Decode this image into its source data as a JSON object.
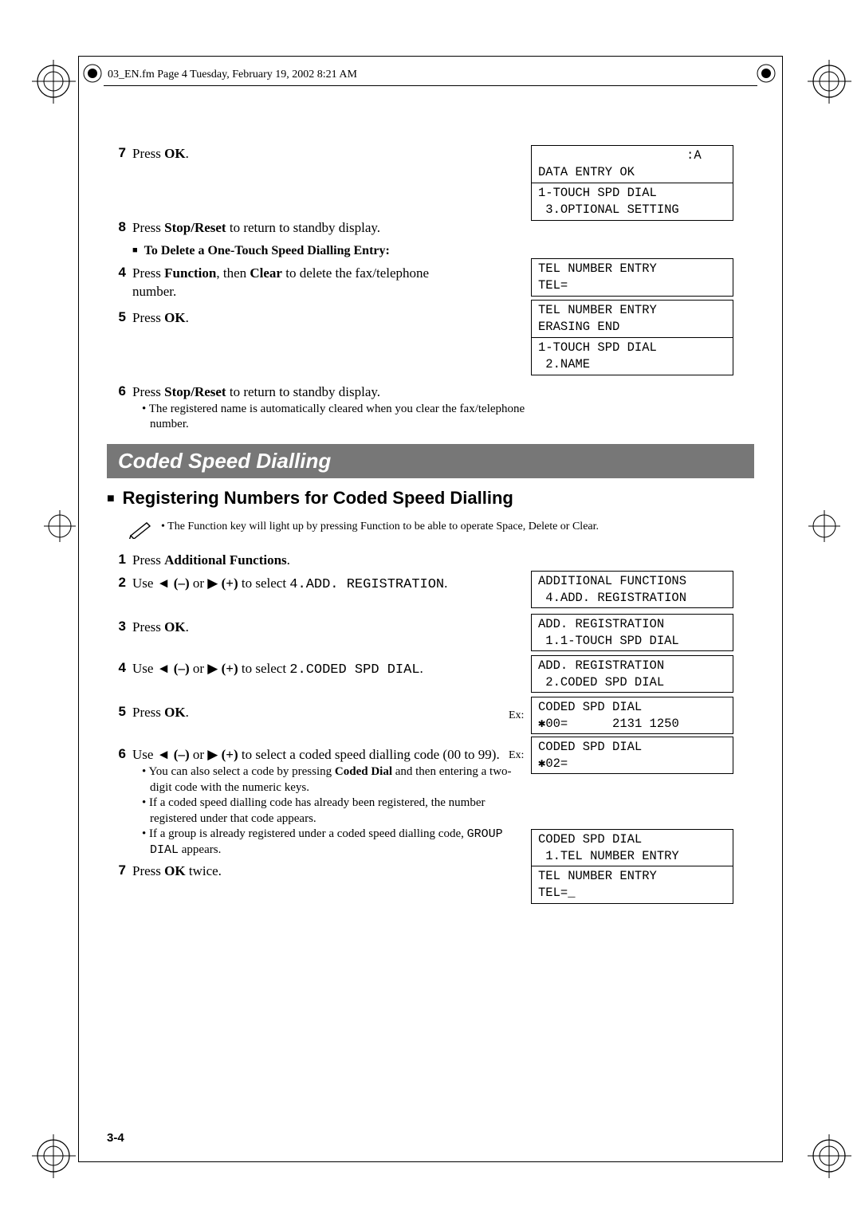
{
  "header": "03_EN.fm  Page 4  Tuesday, February 19, 2002  8:21 AM",
  "stepsA": {
    "s7": {
      "num": "7",
      "text_a": "Press ",
      "bold": "OK",
      "text_b": "."
    },
    "s8": {
      "num": "8",
      "text_a": "Press ",
      "bold": "Stop/Reset",
      "text_b": " to return to standby display."
    },
    "sub": "To Delete a One-Touch Speed Dialling Entry:",
    "s4": {
      "num": "4",
      "text_a": "Press ",
      "bold1": "Function",
      "mid": ", then ",
      "bold2": "Clear",
      "text_b": " to delete the fax/telephone number."
    },
    "s5": {
      "num": "5",
      "text_a": "Press ",
      "bold": "OK",
      "text_b": "."
    },
    "s6": {
      "num": "6",
      "text_a": "Press ",
      "bold": "Stop/Reset",
      "text_b": " to return to standby display.",
      "note": "The registered name is automatically cleared when you clear the fax/telephone number."
    }
  },
  "lcdA": {
    "box1a": "                    :A\nDATA ENTRY OK",
    "box1b": "1-TOUCH SPD DIAL\n 3.OPTIONAL SETTING",
    "box2": "TEL NUMBER ENTRY\nTEL=",
    "box3a": "TEL NUMBER ENTRY\nERASING END",
    "box3b": "1-TOUCH SPD DIAL\n 2.NAME"
  },
  "section": "Coded Speed Dialling",
  "subsection": "Registering Numbers for Coded Speed Dialling",
  "tip": {
    "a": "The ",
    "b1": "Function",
    "c": " key will light up by pressing ",
    "b2": "Function",
    "d": " to be able to operate ",
    "b3": "Space",
    "e": ", ",
    "b4": "Delete",
    "f": " or ",
    "b5": "Clear",
    "g": "."
  },
  "stepsB": {
    "s1": {
      "num": "1",
      "text_a": "Press ",
      "bold": "Additional Functions",
      "text_b": "."
    },
    "s2": {
      "num": "2",
      "text_a": "Use ",
      "l1": "◄",
      "b1": " (–)",
      "or": " or ",
      "r1": "▶",
      "b2": " (+)",
      "tail": " to select ",
      "mono": "4.ADD. REGISTRATION",
      "text_b": "."
    },
    "s3": {
      "num": "3",
      "text_a": "Press ",
      "bold": "OK",
      "text_b": "."
    },
    "s4": {
      "num": "4",
      "text_a": "Use ",
      "l1": "◄",
      "b1": " (–)",
      "or": " or ",
      "r1": "▶",
      "b2": " (+)",
      "tail": " to select ",
      "mono": "2.CODED SPD DIAL",
      "text_b": "."
    },
    "s5": {
      "num": "5",
      "text_a": "Press ",
      "bold": "OK",
      "text_b": "."
    },
    "s6": {
      "num": "6",
      "text_a": "Use ",
      "l1": "◄",
      "b1": " (–)",
      "or": " or ",
      "r1": "▶",
      "b2": " (+)",
      "tail": " to select a coded speed dialling code (00 to 99).",
      "note1a": "You can also select a code by pressing ",
      "note1b": "Coded Dial",
      "note1c": " and then entering a two-digit code with the numeric keys.",
      "note2": "If a coded speed dialling code has already been registered, the number registered under that code appears.",
      "note3a": "If a group is already registered under a coded speed dialling code, ",
      "note3m": "GROUP DIAL",
      "note3b": " appears."
    },
    "s7": {
      "num": "7",
      "text_a": "Press ",
      "bold": "OK",
      "text_b": " twice."
    }
  },
  "lcdB": {
    "b1": "ADDITIONAL FUNCTIONS\n 4.ADD. REGISTRATION",
    "b2": "ADD. REGISTRATION\n 1.1-TOUCH SPD DIAL",
    "b3": "ADD. REGISTRATION\n 2.CODED SPD DIAL",
    "b4": "CODED SPD DIAL\n✱00=      2131 1250",
    "ex1": "Ex:",
    "b5": "CODED SPD DIAL\n✱02=",
    "ex2": "Ex:",
    "b6": "CODED SPD DIAL\n 1.TEL NUMBER ENTRY",
    "b7": "TEL NUMBER ENTRY\nTEL=_"
  },
  "page_num": "3-4"
}
